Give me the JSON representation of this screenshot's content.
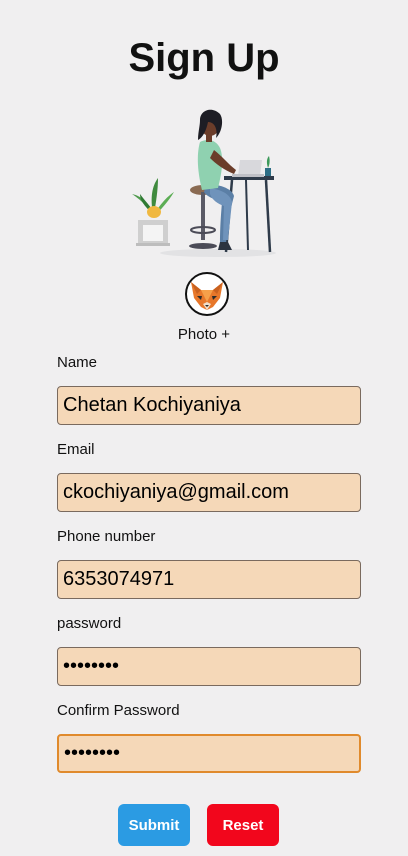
{
  "page": {
    "title": "Sign Up",
    "illustration": "person-working-at-desk-illustration",
    "avatar_icon": "fox-icon",
    "photo_label": "Photo +"
  },
  "form": {
    "name": {
      "label": "Name",
      "value": "Chetan Kochiyaniya"
    },
    "email": {
      "label": "Email",
      "value": "ckochiyaniya@gmail.com"
    },
    "phone": {
      "label": "Phone number",
      "value": "6353074971"
    },
    "password": {
      "label": "password",
      "value": "12345678"
    },
    "confirm_password": {
      "label": "Confirm Password",
      "value": "12345678"
    }
  },
  "buttons": {
    "submit": "Submit",
    "reset": "Reset"
  },
  "colors": {
    "background": "#f0eff0",
    "input_background": "#f5d8b8",
    "focus_border": "#e08a2c",
    "submit": "#2b9be3",
    "reset": "#f2061c"
  }
}
